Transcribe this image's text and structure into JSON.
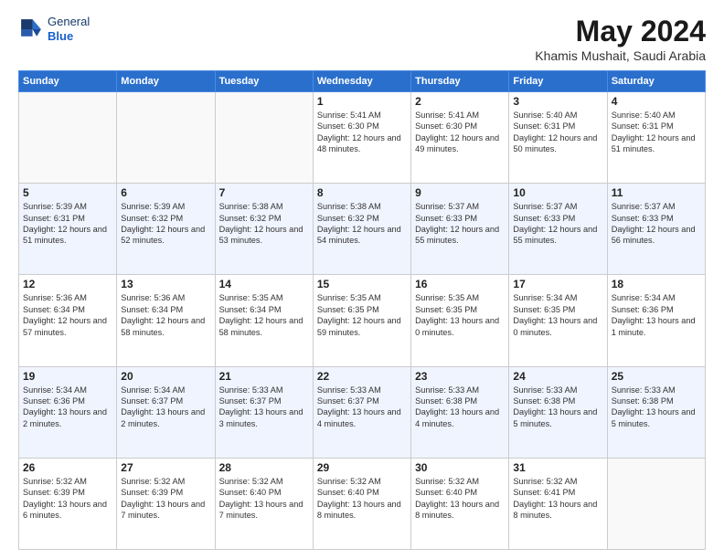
{
  "header": {
    "logo_line1": "General",
    "logo_line2": "Blue",
    "month": "May 2024",
    "location": "Khamis Mushait, Saudi Arabia"
  },
  "weekdays": [
    "Sunday",
    "Monday",
    "Tuesday",
    "Wednesday",
    "Thursday",
    "Friday",
    "Saturday"
  ],
  "weeks": [
    [
      {
        "day": "",
        "sunrise": "",
        "sunset": "",
        "daylight": ""
      },
      {
        "day": "",
        "sunrise": "",
        "sunset": "",
        "daylight": ""
      },
      {
        "day": "",
        "sunrise": "",
        "sunset": "",
        "daylight": ""
      },
      {
        "day": "1",
        "sunrise": "Sunrise: 5:41 AM",
        "sunset": "Sunset: 6:30 PM",
        "daylight": "Daylight: 12 hours and 48 minutes."
      },
      {
        "day": "2",
        "sunrise": "Sunrise: 5:41 AM",
        "sunset": "Sunset: 6:30 PM",
        "daylight": "Daylight: 12 hours and 49 minutes."
      },
      {
        "day": "3",
        "sunrise": "Sunrise: 5:40 AM",
        "sunset": "Sunset: 6:31 PM",
        "daylight": "Daylight: 12 hours and 50 minutes."
      },
      {
        "day": "4",
        "sunrise": "Sunrise: 5:40 AM",
        "sunset": "Sunset: 6:31 PM",
        "daylight": "Daylight: 12 hours and 51 minutes."
      }
    ],
    [
      {
        "day": "5",
        "sunrise": "Sunrise: 5:39 AM",
        "sunset": "Sunset: 6:31 PM",
        "daylight": "Daylight: 12 hours and 51 minutes."
      },
      {
        "day": "6",
        "sunrise": "Sunrise: 5:39 AM",
        "sunset": "Sunset: 6:32 PM",
        "daylight": "Daylight: 12 hours and 52 minutes."
      },
      {
        "day": "7",
        "sunrise": "Sunrise: 5:38 AM",
        "sunset": "Sunset: 6:32 PM",
        "daylight": "Daylight: 12 hours and 53 minutes."
      },
      {
        "day": "8",
        "sunrise": "Sunrise: 5:38 AM",
        "sunset": "Sunset: 6:32 PM",
        "daylight": "Daylight: 12 hours and 54 minutes."
      },
      {
        "day": "9",
        "sunrise": "Sunrise: 5:37 AM",
        "sunset": "Sunset: 6:33 PM",
        "daylight": "Daylight: 12 hours and 55 minutes."
      },
      {
        "day": "10",
        "sunrise": "Sunrise: 5:37 AM",
        "sunset": "Sunset: 6:33 PM",
        "daylight": "Daylight: 12 hours and 55 minutes."
      },
      {
        "day": "11",
        "sunrise": "Sunrise: 5:37 AM",
        "sunset": "Sunset: 6:33 PM",
        "daylight": "Daylight: 12 hours and 56 minutes."
      }
    ],
    [
      {
        "day": "12",
        "sunrise": "Sunrise: 5:36 AM",
        "sunset": "Sunset: 6:34 PM",
        "daylight": "Daylight: 12 hours and 57 minutes."
      },
      {
        "day": "13",
        "sunrise": "Sunrise: 5:36 AM",
        "sunset": "Sunset: 6:34 PM",
        "daylight": "Daylight: 12 hours and 58 minutes."
      },
      {
        "day": "14",
        "sunrise": "Sunrise: 5:35 AM",
        "sunset": "Sunset: 6:34 PM",
        "daylight": "Daylight: 12 hours and 58 minutes."
      },
      {
        "day": "15",
        "sunrise": "Sunrise: 5:35 AM",
        "sunset": "Sunset: 6:35 PM",
        "daylight": "Daylight: 12 hours and 59 minutes."
      },
      {
        "day": "16",
        "sunrise": "Sunrise: 5:35 AM",
        "sunset": "Sunset: 6:35 PM",
        "daylight": "Daylight: 13 hours and 0 minutes."
      },
      {
        "day": "17",
        "sunrise": "Sunrise: 5:34 AM",
        "sunset": "Sunset: 6:35 PM",
        "daylight": "Daylight: 13 hours and 0 minutes."
      },
      {
        "day": "18",
        "sunrise": "Sunrise: 5:34 AM",
        "sunset": "Sunset: 6:36 PM",
        "daylight": "Daylight: 13 hours and 1 minute."
      }
    ],
    [
      {
        "day": "19",
        "sunrise": "Sunrise: 5:34 AM",
        "sunset": "Sunset: 6:36 PM",
        "daylight": "Daylight: 13 hours and 2 minutes."
      },
      {
        "day": "20",
        "sunrise": "Sunrise: 5:34 AM",
        "sunset": "Sunset: 6:37 PM",
        "daylight": "Daylight: 13 hours and 2 minutes."
      },
      {
        "day": "21",
        "sunrise": "Sunrise: 5:33 AM",
        "sunset": "Sunset: 6:37 PM",
        "daylight": "Daylight: 13 hours and 3 minutes."
      },
      {
        "day": "22",
        "sunrise": "Sunrise: 5:33 AM",
        "sunset": "Sunset: 6:37 PM",
        "daylight": "Daylight: 13 hours and 4 minutes."
      },
      {
        "day": "23",
        "sunrise": "Sunrise: 5:33 AM",
        "sunset": "Sunset: 6:38 PM",
        "daylight": "Daylight: 13 hours and 4 minutes."
      },
      {
        "day": "24",
        "sunrise": "Sunrise: 5:33 AM",
        "sunset": "Sunset: 6:38 PM",
        "daylight": "Daylight: 13 hours and 5 minutes."
      },
      {
        "day": "25",
        "sunrise": "Sunrise: 5:33 AM",
        "sunset": "Sunset: 6:38 PM",
        "daylight": "Daylight: 13 hours and 5 minutes."
      }
    ],
    [
      {
        "day": "26",
        "sunrise": "Sunrise: 5:32 AM",
        "sunset": "Sunset: 6:39 PM",
        "daylight": "Daylight: 13 hours and 6 minutes."
      },
      {
        "day": "27",
        "sunrise": "Sunrise: 5:32 AM",
        "sunset": "Sunset: 6:39 PM",
        "daylight": "Daylight: 13 hours and 7 minutes."
      },
      {
        "day": "28",
        "sunrise": "Sunrise: 5:32 AM",
        "sunset": "Sunset: 6:40 PM",
        "daylight": "Daylight: 13 hours and 7 minutes."
      },
      {
        "day": "29",
        "sunrise": "Sunrise: 5:32 AM",
        "sunset": "Sunset: 6:40 PM",
        "daylight": "Daylight: 13 hours and 8 minutes."
      },
      {
        "day": "30",
        "sunrise": "Sunrise: 5:32 AM",
        "sunset": "Sunset: 6:40 PM",
        "daylight": "Daylight: 13 hours and 8 minutes."
      },
      {
        "day": "31",
        "sunrise": "Sunrise: 5:32 AM",
        "sunset": "Sunset: 6:41 PM",
        "daylight": "Daylight: 13 hours and 8 minutes."
      },
      {
        "day": "",
        "sunrise": "",
        "sunset": "",
        "daylight": ""
      }
    ]
  ]
}
